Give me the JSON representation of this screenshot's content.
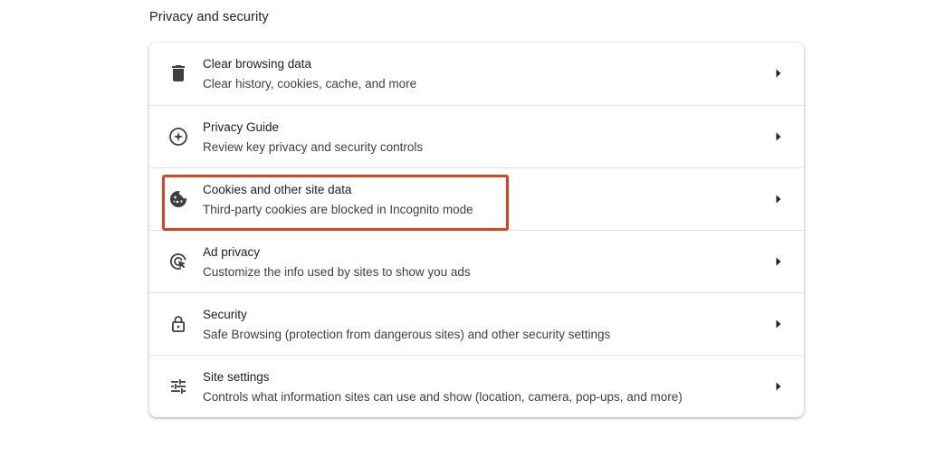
{
  "section": {
    "title": "Privacy and security"
  },
  "rows": [
    {
      "icon": "trash-icon",
      "title": "Clear browsing data",
      "subtitle": "Clear history, cookies, cache, and more"
    },
    {
      "icon": "compass-icon",
      "title": "Privacy Guide",
      "subtitle": "Review key privacy and security controls"
    },
    {
      "icon": "cookie-icon",
      "title": "Cookies and other site data",
      "subtitle": "Third-party cookies are blocked in Incognito mode"
    },
    {
      "icon": "ad-privacy-icon",
      "title": "Ad privacy",
      "subtitle": "Customize the info used by sites to show you ads"
    },
    {
      "icon": "lock-icon",
      "title": "Security",
      "subtitle": "Safe Browsing (protection from dangerous sites) and other security settings"
    },
    {
      "icon": "sliders-icon",
      "title": "Site settings",
      "subtitle": "Controls what information sites can use and show (location, camera, pop-ups, and more)"
    }
  ],
  "colors": {
    "highlight_border": "#d9431e",
    "icon": "#5f6368",
    "text_primary": "#202124",
    "text_secondary": "#3c4043"
  }
}
